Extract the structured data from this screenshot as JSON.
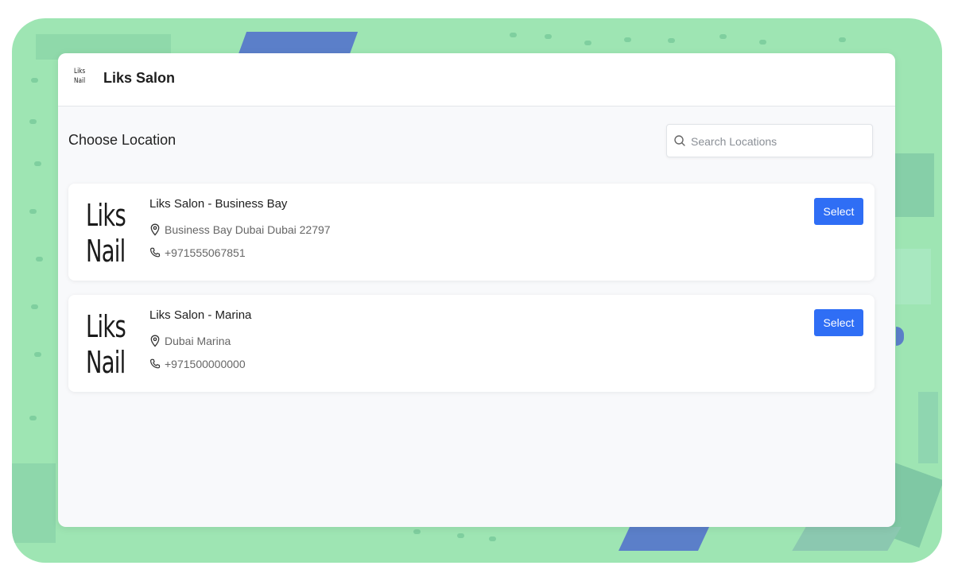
{
  "header": {
    "logo_line1": "Liks",
    "logo_line2": "Nail",
    "title": "Liks Salon"
  },
  "main": {
    "heading": "Choose Location",
    "search": {
      "placeholder": "Search Locations",
      "icon": "search-icon"
    }
  },
  "locations": [
    {
      "logo_line1": "Liks",
      "logo_line2": "Nail",
      "name": "Liks Salon - Business Bay",
      "address": "Business Bay Dubai Dubai 22797",
      "phone": "+971555067851",
      "select_label": "Select"
    },
    {
      "logo_line1": "Liks",
      "logo_line2": "Nail",
      "name": "Liks Salon - Marina",
      "address": "Dubai Marina",
      "phone": "+971500000000",
      "select_label": "Select"
    }
  ],
  "colors": {
    "background": "#9ee5b3",
    "accent": "#2f6ef5",
    "deco_blue": "#5b7fc9"
  }
}
